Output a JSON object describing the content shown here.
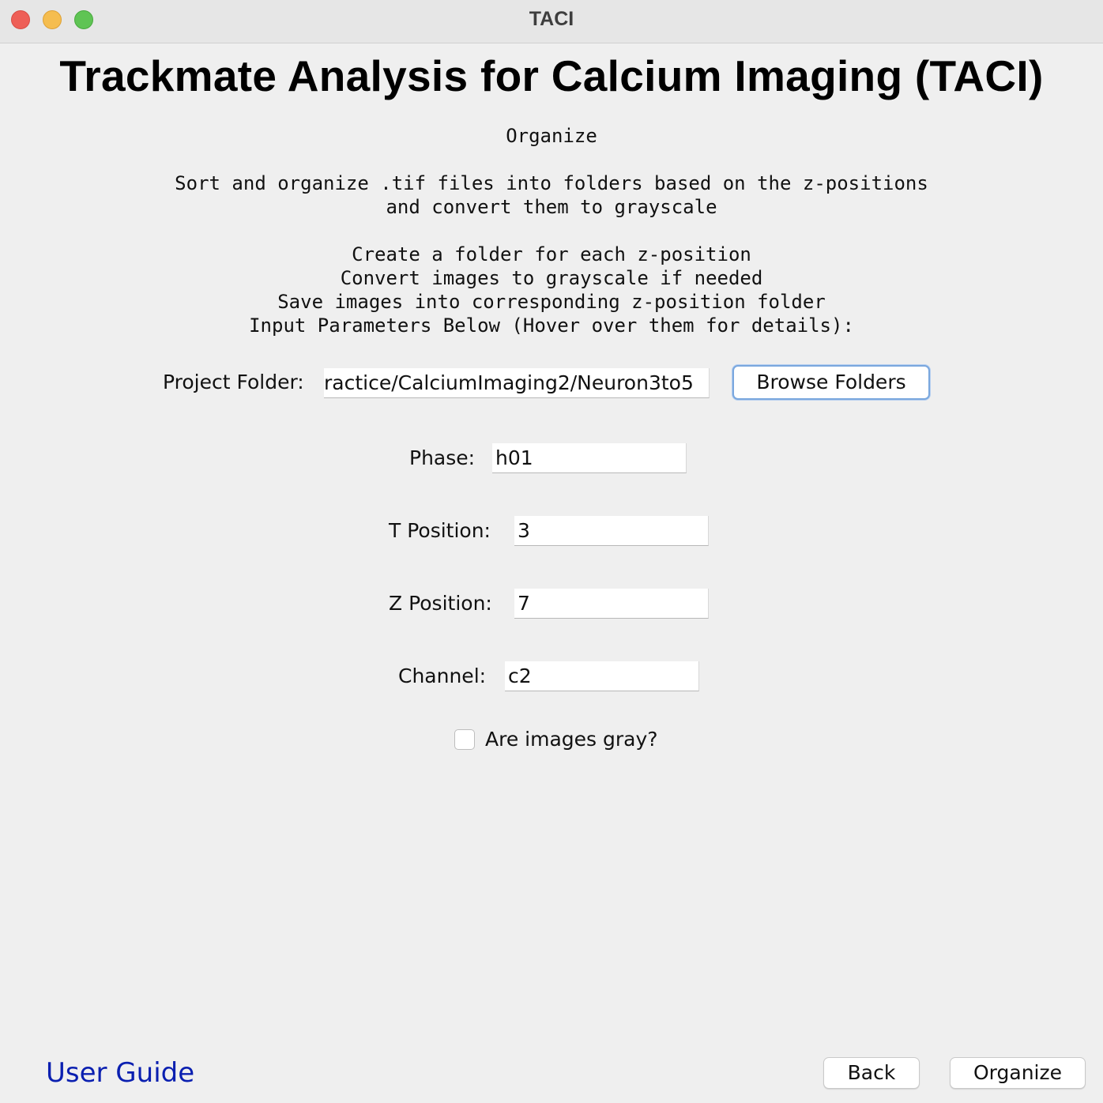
{
  "window": {
    "title": "TACI"
  },
  "heading": "Trackmate Analysis for Calcium Imaging (TACI)",
  "step_title": "Organize",
  "description": {
    "line1": "Sort and organize .tif files into folders based on the z-positions",
    "line2": "and convert them to grayscale"
  },
  "steps": [
    "Create a folder for each z-position",
    "Convert images to grayscale if needed",
    "Save images into corresponding z-position folder",
    "Input Parameters Below (Hover over them for details):"
  ],
  "form": {
    "project_folder": {
      "label": "Project Folder:",
      "value": "ractice/CalciumImaging2/Neuron3to5",
      "browse_label": "Browse Folders"
    },
    "phase": {
      "label": "Phase:",
      "value": "h01"
    },
    "t_position": {
      "label": "T Position:",
      "value": "3"
    },
    "z_position": {
      "label": "Z Position:",
      "value": "7"
    },
    "channel": {
      "label": "Channel:",
      "value": "c2"
    },
    "gray_checkbox": {
      "label": "Are images gray?",
      "checked": false
    }
  },
  "footer": {
    "user_guide_label": "User Guide",
    "back_label": "Back",
    "organize_label": "Organize"
  },
  "colors": {
    "link": "#0a1fb0",
    "focus_ring": "#7aa7de",
    "close": "#ee5f57",
    "minimize": "#f5bd4f",
    "maximize": "#5fc454"
  }
}
